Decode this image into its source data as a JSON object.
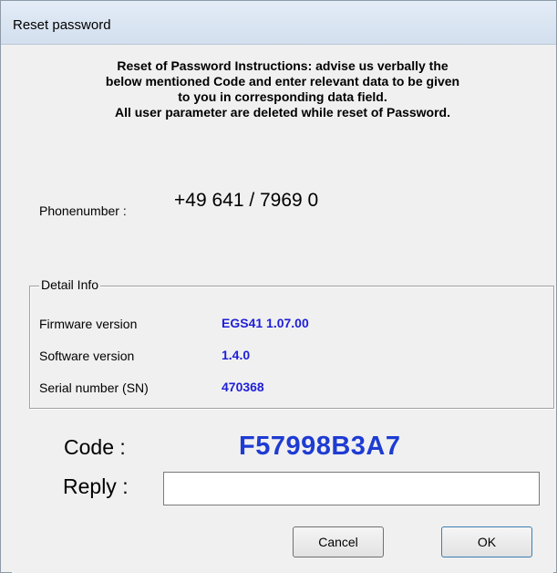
{
  "window": {
    "title": "Reset password"
  },
  "instructions": {
    "line1": "Reset of Password Instructions: advise us verbally the",
    "line2": "below mentioned Code and enter relevant data to be given",
    "line3": "to you in corresponding data field.",
    "line4": "All user parameter are deleted while reset of Password."
  },
  "phone": {
    "label": "Phonenumber :",
    "value": "+49 641 / 7969 0"
  },
  "detail_info": {
    "title": "Detail Info",
    "rows": [
      {
        "label": "Firmware version",
        "value": "EGS41 1.07.00"
      },
      {
        "label": "Software version",
        "value": "1.4.0"
      },
      {
        "label": "Serial number (SN)",
        "value": "470368"
      }
    ]
  },
  "code": {
    "label": "Code :",
    "value": "F57998B3A7"
  },
  "reply": {
    "label": "Reply :",
    "value": ""
  },
  "buttons": {
    "cancel": "Cancel",
    "ok": "OK"
  },
  "colors": {
    "value_blue": "#1f1fd8",
    "code_blue": "#1e3cd2",
    "dialog_bg": "#f0f0f0"
  }
}
